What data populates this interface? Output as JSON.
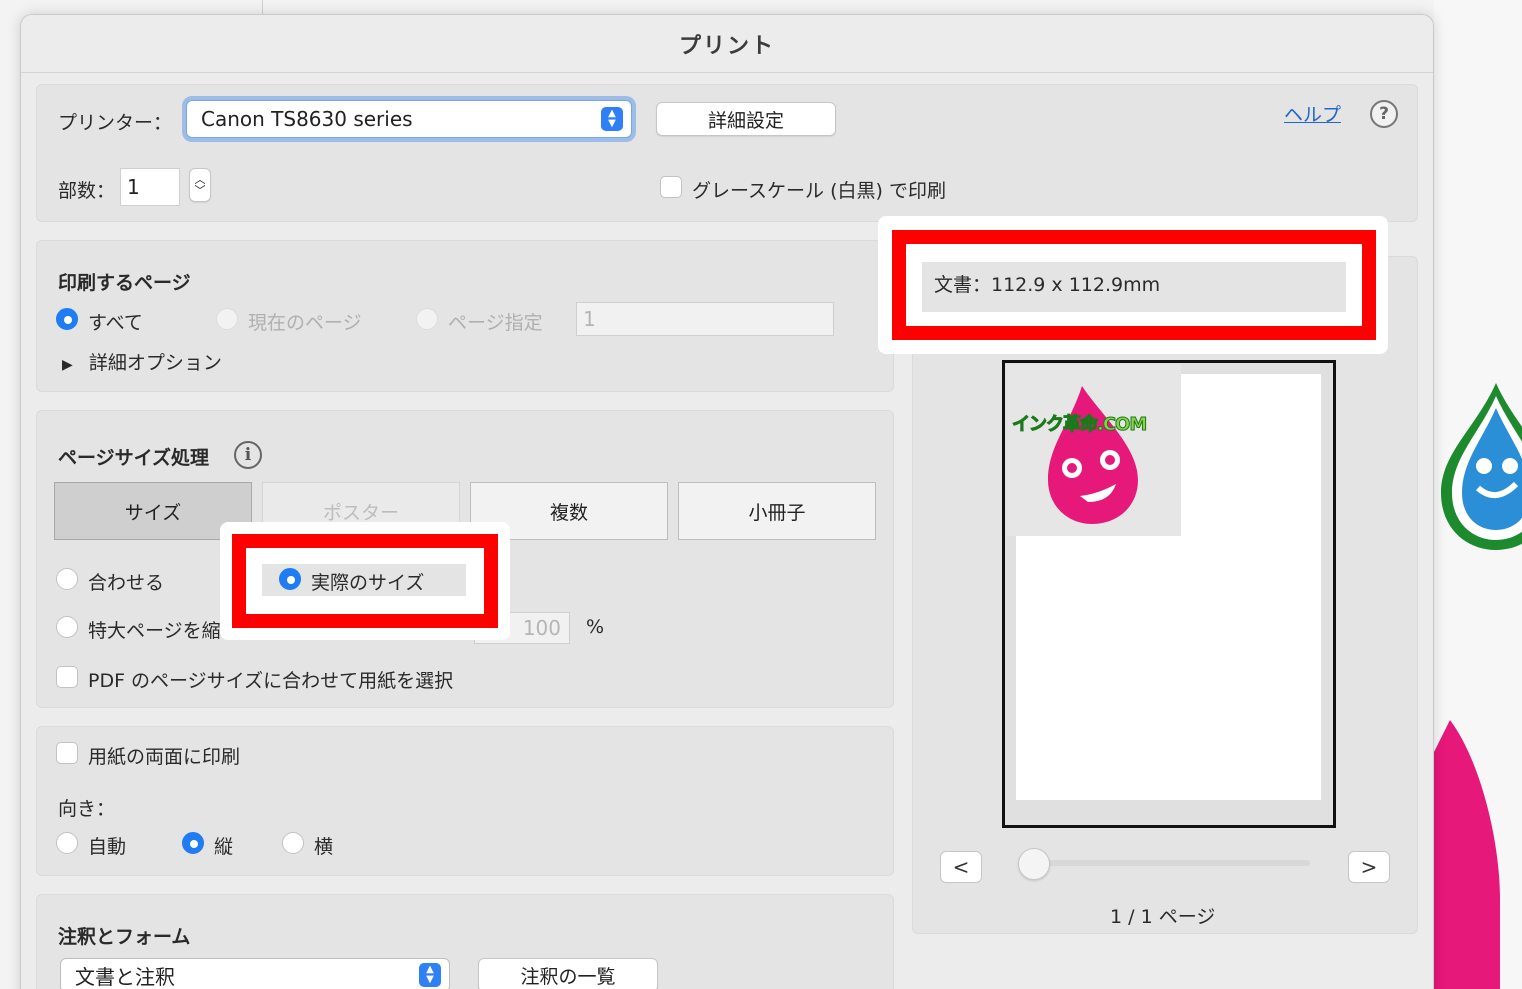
{
  "dialog": {
    "title": "プリント"
  },
  "printer": {
    "label": "プリンター：",
    "selected": "Canon TS8630 series",
    "details_button": "詳細設定",
    "help_link": "ヘルプ",
    "help_icon": "question-mark-icon"
  },
  "copies": {
    "label": "部数：",
    "value": "1"
  },
  "grayscale": {
    "label": "グレースケール (白黒) で印刷",
    "checked": false
  },
  "pages": {
    "title": "印刷するページ",
    "all": "すべて",
    "current": "現在のページ",
    "range": "ページ指定",
    "range_value": "1",
    "more_options": "詳細オプション"
  },
  "page_sizing": {
    "title": "ページサイズ処理",
    "tabs": [
      "サイズ",
      "ポスター",
      "複数",
      "小冊子"
    ],
    "fit": "合わせる",
    "actual": "実際のサイズ",
    "shrink": "特大ページを縮小",
    "custom_value": "100",
    "percent": "%",
    "pdf_paper": "PDF のページサイズに合わせて用紙を選択"
  },
  "duplex": {
    "label": "用紙の両面に印刷"
  },
  "orientation": {
    "label": "向き：",
    "auto": "自動",
    "portrait": "縦",
    "landscape": "横"
  },
  "annotations": {
    "title": "注釈とフォーム",
    "selected": "文書と注釈",
    "summary_button": "注釈の一覧"
  },
  "preview": {
    "doc_size": "文書：112.9 x 112.9mm",
    "logo_text": "インク革命.COM",
    "page_indicator": "1 / 1 ページ",
    "prev": "<",
    "next": ">"
  },
  "colors": {
    "accent": "#1f7cf2",
    "highlight": "#ff0000",
    "mascot": "#e6187a"
  }
}
